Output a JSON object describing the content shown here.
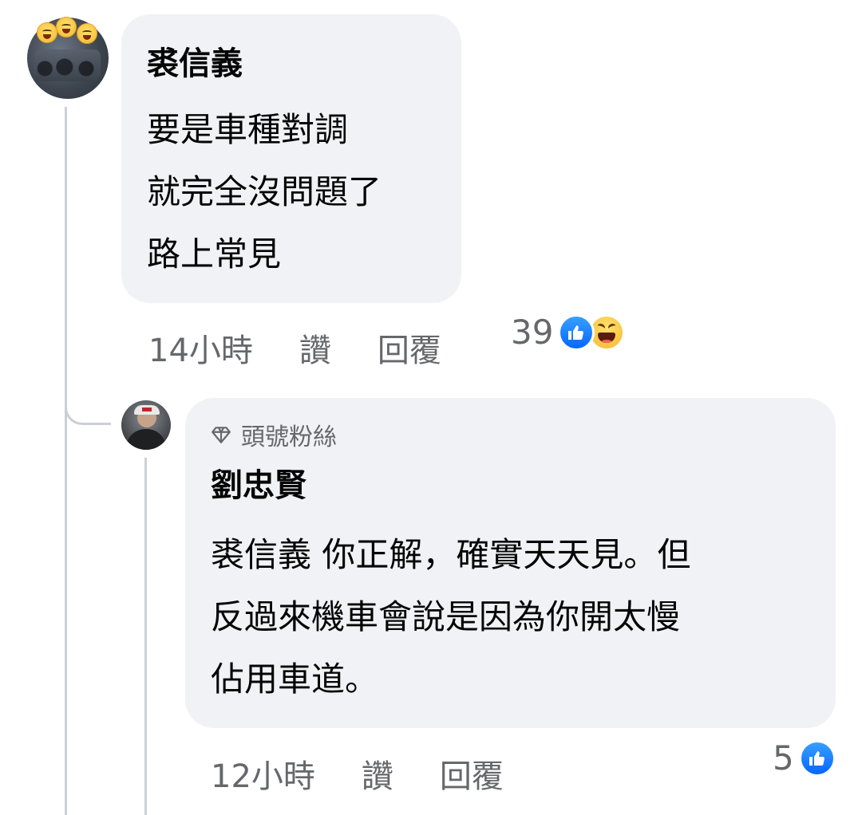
{
  "comments": [
    {
      "author": "裘信義",
      "lines": [
        "要是車種對調",
        "就完全沒問題了",
        "路上常見"
      ],
      "time": "14小時",
      "like_label": "讚",
      "reply_label": "回覆",
      "reaction_count": "39",
      "reactions": [
        "like-icon",
        "haha-icon"
      ]
    },
    {
      "badge": "頭號粉絲",
      "author": "劉忠賢",
      "lines": [
        "裘信義 你正解，確實天天見。但",
        "反過來機車會說是因為你開太慢",
        "佔用車道。"
      ],
      "time": "12小時",
      "like_label": "讚",
      "reply_label": "回覆",
      "reaction_count": "5",
      "reactions": [
        "like-icon"
      ]
    }
  ],
  "colors": {
    "bubble": "#f0f2f5",
    "secondary_text": "#65676b",
    "like_blue": "#0866ff",
    "thread_line": "#ccd0d5"
  }
}
